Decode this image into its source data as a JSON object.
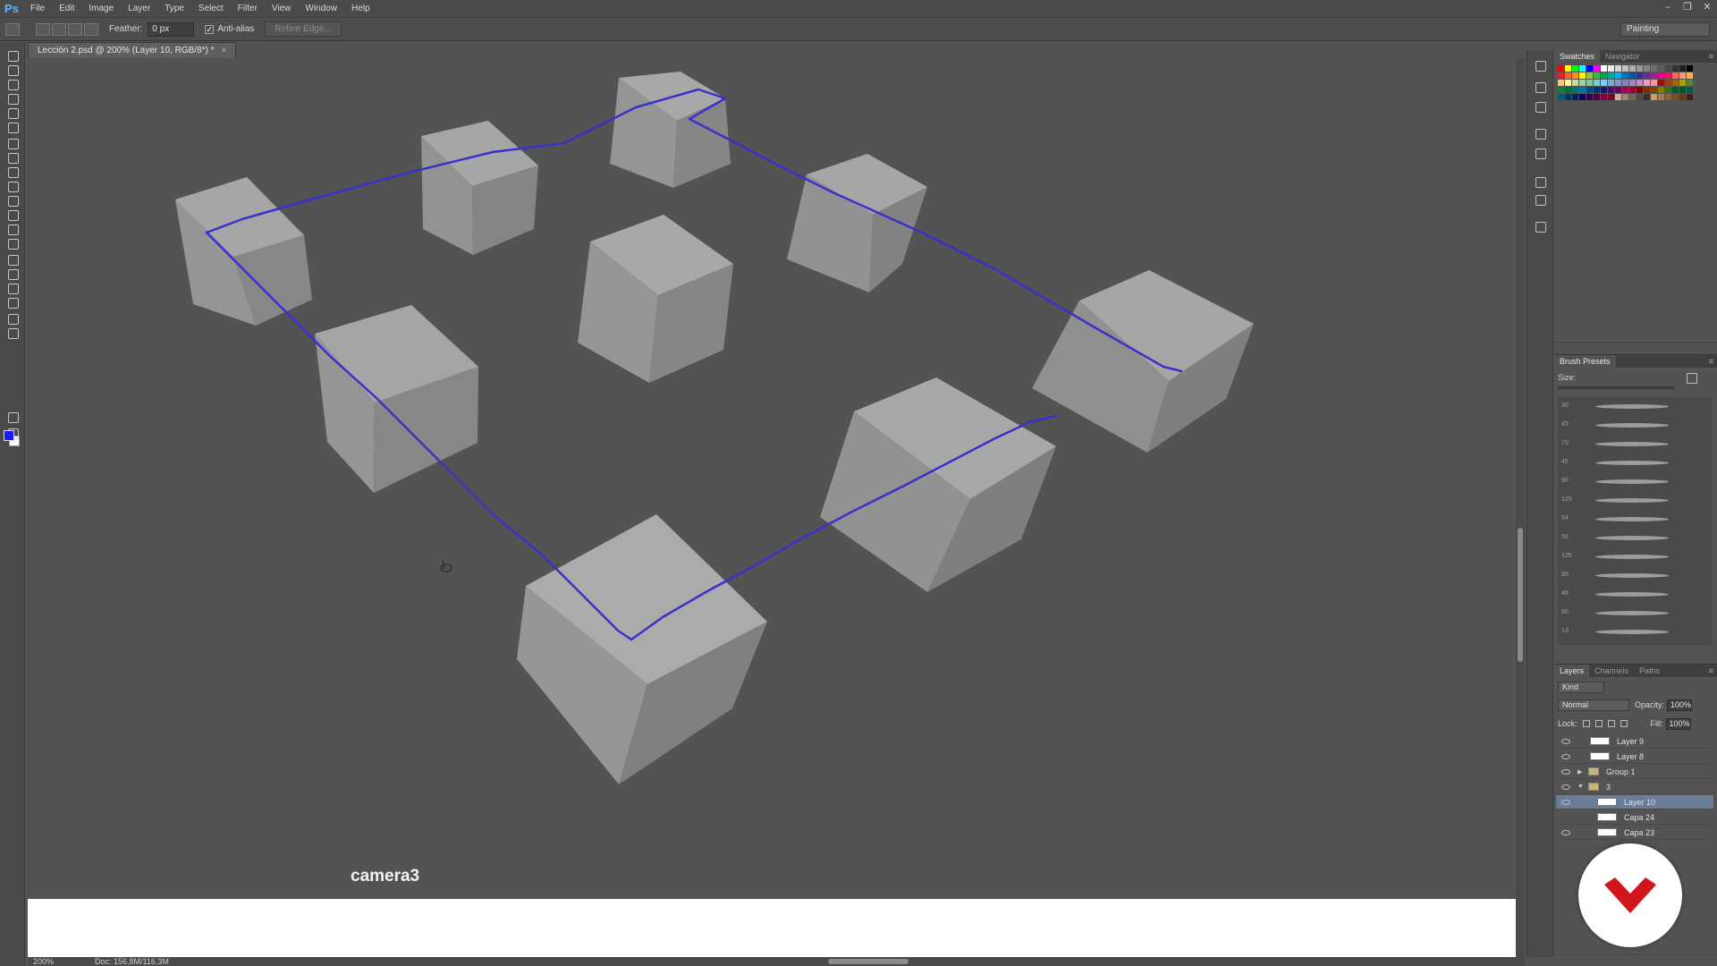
{
  "app": {
    "logo": "Ps"
  },
  "menu": [
    "File",
    "Edit",
    "Image",
    "Layer",
    "Type",
    "Select",
    "Filter",
    "View",
    "Window",
    "Help"
  ],
  "window_controls": [
    "–",
    "❐",
    "✕"
  ],
  "options_bar": {
    "feather_label": "Feather:",
    "feather_value": "0 px",
    "antialias_label": "Anti-alias",
    "antialias_checked": true,
    "refine_edge_label": "Refine Edge...",
    "workspace": "Painting"
  },
  "document": {
    "tab_title": "Lección 2.psd @ 200% (Layer 10, RGB/8*) *",
    "tab_close": "×",
    "caption": "camera3"
  },
  "status_bar": {
    "zoom": "200%",
    "doc_info": "Doc: 156,8M/116,3M"
  },
  "colors": {
    "foreground": "#1a1aff",
    "background": "#ffffff",
    "guide_line": "#3b31c9",
    "canvas_bg": "#535353",
    "cube_top": "#a9a9a9",
    "cube_left": "#959595",
    "cube_right": "#7c7c7c"
  },
  "swatches_panel": {
    "tabs": [
      "Swatches",
      "Navigator"
    ],
    "colors": [
      "#ff0000",
      "#ffff00",
      "#00ff00",
      "#00ffff",
      "#0000ff",
      "#ff00ff",
      "#ffffff",
      "#ebebeb",
      "#d6d6d6",
      "#c2c2c2",
      "#adadad",
      "#999999",
      "#858585",
      "#707070",
      "#5c5c5c",
      "#474747",
      "#333333",
      "#1f1f1f",
      "#000000",
      "#ee1d24",
      "#f26522",
      "#f7941d",
      "#fff200",
      "#8dc63f",
      "#39b54a",
      "#00a651",
      "#00a99d",
      "#00aeef",
      "#0072bc",
      "#0054a6",
      "#2e3192",
      "#662d91",
      "#92278f",
      "#ec008c",
      "#ed145b",
      "#f26c4f",
      "#f69679",
      "#fbaf5d",
      "#fdc689",
      "#fff799",
      "#c4df9b",
      "#a3d39c",
      "#82ca9c",
      "#7accc8",
      "#6dcff6",
      "#7da7d9",
      "#8393ca",
      "#8781bd",
      "#a186be",
      "#bd8cbf",
      "#f49ac1",
      "#f5989d",
      "#9e0b0f",
      "#a0410d",
      "#a36209",
      "#aba000",
      "#598527",
      "#1a7b30",
      "#007236",
      "#00746b",
      "#0076a3",
      "#004a80",
      "#003471",
      "#1b1464",
      "#440e62",
      "#630460",
      "#9e005d",
      "#9e0039",
      "#790000",
      "#7b2e00",
      "#7d4900",
      "#827b00",
      "#406618",
      "#005e20",
      "#005826",
      "#005952",
      "#005b7f",
      "#003663",
      "#002157",
      "#0d004c",
      "#32004b",
      "#4b0049",
      "#7b0046",
      "#7a0026",
      "#c7b299",
      "#998675",
      "#736357",
      "#534741",
      "#37302a",
      "#c69c6d",
      "#a67c52",
      "#8c6239",
      "#754c24",
      "#603913",
      "#3c2415"
    ]
  },
  "brush_presets": {
    "title": "Brush Presets",
    "size_label": "Size:",
    "sizes": [
      "30",
      "45",
      "70",
      "45",
      "90",
      "125",
      "54",
      "50",
      "125",
      "95",
      "48",
      "60",
      "13"
    ]
  },
  "layers_panel": {
    "tabs": [
      "Layers",
      "Channels",
      "Paths"
    ],
    "kind": "Kind",
    "blend_mode": "Normal",
    "opacity_label": "Opacity:",
    "opacity": "100%",
    "lock_label": "Lock:",
    "fill_label": "Fill:",
    "fill": "100%",
    "layers": [
      {
        "name": "Layer 9",
        "type": "layer",
        "visible": true,
        "selected": false,
        "indent": 0
      },
      {
        "name": "Layer 8",
        "type": "layer",
        "visible": true,
        "selected": false,
        "indent": 0
      },
      {
        "name": "Group 1",
        "type": "group",
        "visible": true,
        "selected": false,
        "indent": 0,
        "expanded": false
      },
      {
        "name": "3",
        "type": "group",
        "visible": true,
        "selected": false,
        "indent": 0,
        "expanded": true
      },
      {
        "name": "Layer 10",
        "type": "layer",
        "visible": true,
        "selected": true,
        "indent": 1
      },
      {
        "name": "Capa 24",
        "type": "layer",
        "visible": false,
        "selected": false,
        "indent": 1
      },
      {
        "name": "Capa 23",
        "type": "layer",
        "visible": true,
        "selected": false,
        "indent": 1
      }
    ]
  }
}
